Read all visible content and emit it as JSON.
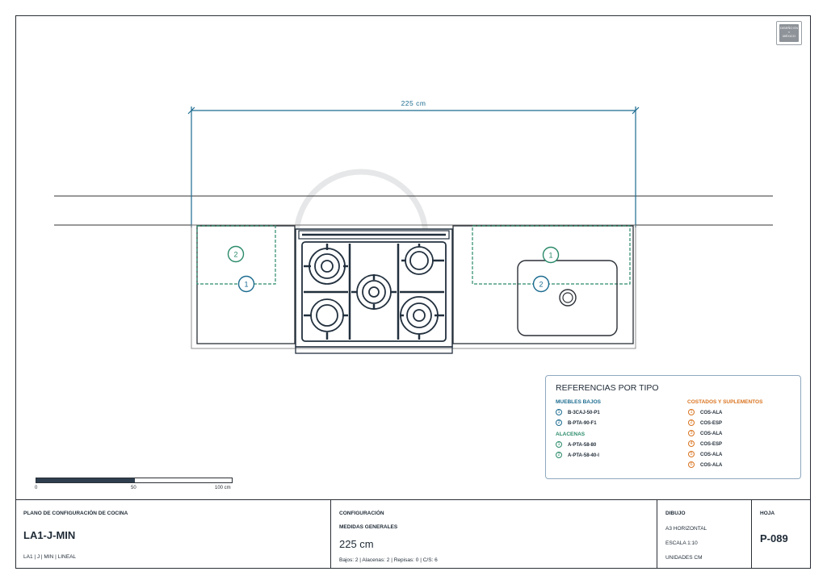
{
  "plan": {
    "dimension_label": "225 cm",
    "markers": {
      "top_left": "2",
      "mid_left": "1",
      "top_right": "1",
      "mid_right": "2"
    }
  },
  "logo": {
    "line1": "DISEÑO EN",
    "line2": "MÉXICO"
  },
  "legend": {
    "title": "REFERENCIAS POR TIPO",
    "muebles_bajos": {
      "heading": "MUEBLES BAJOS",
      "items": [
        {
          "num": "1",
          "code": "B-3CAJ-50-P1"
        },
        {
          "num": "2",
          "code": "B-PTA-90-F1"
        }
      ]
    },
    "alacenas": {
      "heading": "ALACENAS",
      "items": [
        {
          "num": "1",
          "code": "A-PTA-58-80"
        },
        {
          "num": "2",
          "code": "A-PTA-58-40-I"
        }
      ]
    },
    "costados": {
      "heading": "COSTADOS Y SUPLEMENTOS",
      "items": [
        {
          "num": "1",
          "code": "COS-ALA"
        },
        {
          "num": "2",
          "code": "COS-ESP"
        },
        {
          "num": "3",
          "code": "COS-ALA"
        },
        {
          "num": "4",
          "code": "COS-ESP"
        },
        {
          "num": "5",
          "code": "COS-ALA"
        },
        {
          "num": "6",
          "code": "COS-ALA"
        }
      ]
    },
    "colors": {
      "blue": "#1b6b8f",
      "green": "#2a8a6a",
      "orange": "#d9731f"
    }
  },
  "scale_bar": {
    "labels": [
      "0",
      "50",
      "100 cm"
    ],
    "fraction_filled": 0.5
  },
  "title_block": {
    "plan": {
      "heading": "PLANO DE CONFIGURACIÓN DE COCINA",
      "code": "LA1-J-MIN",
      "sub": "LA1 | J | MIN | LINEAL"
    },
    "config": {
      "heading": "CONFIGURACIÓN",
      "subheading": "MEDIDAS GENERALES",
      "value": "225 cm",
      "detail": "Bajos: 2 | Alacenas: 2 | Repisas: 0 | C/S: 6"
    },
    "drawing": {
      "heading": "DIBUJO",
      "format": "A3 HORIZONTAL",
      "scale": "ESCALA 1:10",
      "units": "UNIDADES CM"
    },
    "sheet": {
      "heading": "HOJA",
      "number": "P-089"
    }
  }
}
